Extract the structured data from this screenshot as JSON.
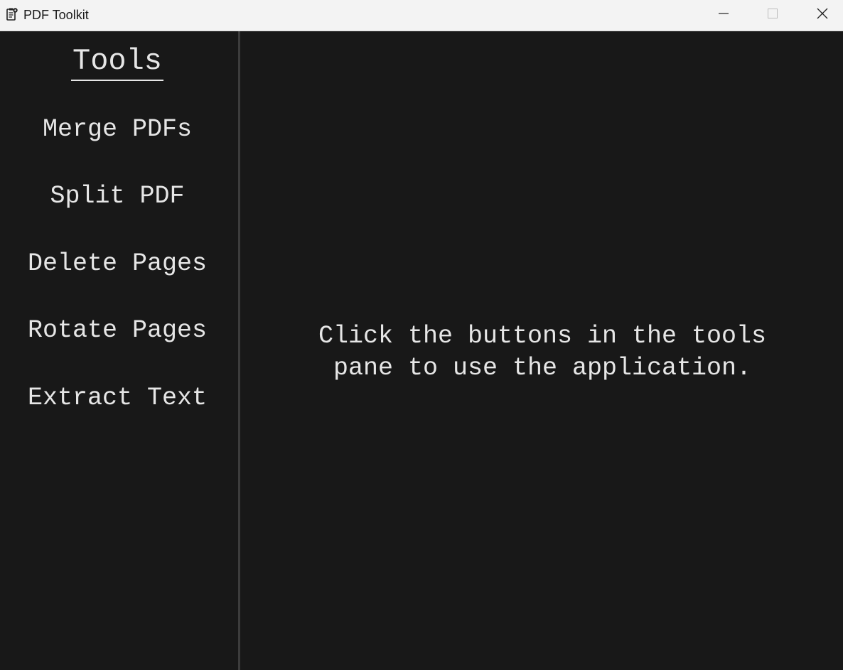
{
  "window": {
    "title": "PDF Toolkit",
    "app_icon": "clipboard-gear-icon",
    "controls": {
      "minimize_icon": "minimize-icon",
      "maximize_icon": "maximize-icon",
      "close_icon": "close-icon"
    }
  },
  "sidebar": {
    "heading": "Tools",
    "buttons": [
      {
        "label": "Merge PDFs"
      },
      {
        "label": "Split PDF"
      },
      {
        "label": "Delete Pages"
      },
      {
        "label": "Rotate Pages"
      },
      {
        "label": "Extract Text"
      }
    ]
  },
  "main": {
    "instructions_line1": "Click the buttons in the tools",
    "instructions_line2": "pane to use the application."
  },
  "colors": {
    "background": "#181818",
    "text": "#e6e6e6",
    "divider": "#3c3c3c",
    "titlebar": "#f3f3f3"
  }
}
